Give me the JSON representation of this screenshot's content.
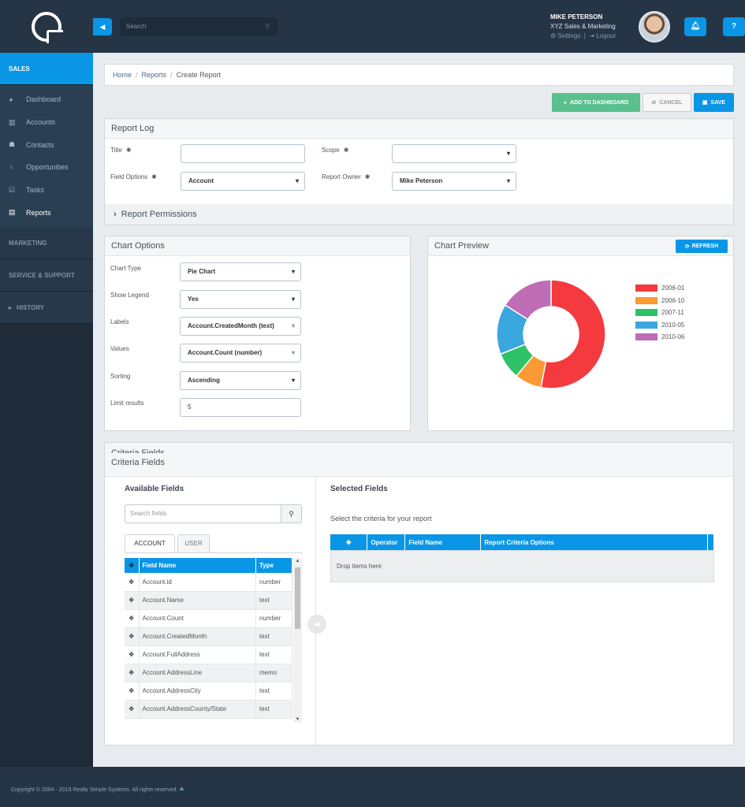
{
  "sidebar": {
    "sections": [
      {
        "label": "SALES"
      },
      {
        "label": "MARKETING"
      },
      {
        "label": "SERVICE & SUPPORT"
      },
      {
        "label": "HISTORY"
      }
    ],
    "items": [
      {
        "label": "Dashboard",
        "icon": "dashboard-icon"
      },
      {
        "label": "Accounts",
        "icon": "accounts-icon"
      },
      {
        "label": "Contacts",
        "icon": "contacts-icon"
      },
      {
        "label": "Opportunities",
        "icon": "opportunities-icon"
      },
      {
        "label": "Tasks",
        "icon": "tasks-icon"
      },
      {
        "label": "Reports",
        "icon": "reports-icon"
      }
    ]
  },
  "topbar": {
    "search_placeholder": "Search",
    "user_name": "MIKE PETERSON",
    "company": "XYZ Sales & Marketing",
    "settings_label": "Settings",
    "logout_label": "Logout",
    "help_label": "?"
  },
  "breadcrumb": [
    "Home",
    "Reports",
    "Create Report"
  ],
  "actions": {
    "add_to_dashboard": "ADD TO DASHBOARD",
    "cancel": "CANCEL",
    "save": "SAVE"
  },
  "report_log": {
    "title": "Report Log",
    "title_label": "Title",
    "title_value": "",
    "scope_label": "Scope",
    "scope_value": "",
    "field_options_label": "Field Options",
    "field_options_value": "Account",
    "report_owner_label": "Report Owner",
    "report_owner_value": "Mike Peterson",
    "permissions_label": "Report Permissions"
  },
  "chart_options": {
    "title": "Chart Options",
    "chart_type_label": "Chart Type",
    "chart_type_value": "Pie Chart",
    "show_legend_label": "Show Legend",
    "show_legend_value": "Yes",
    "labels_label": "Labels",
    "labels_value": "Account.CreatedMonth (text)",
    "values_label": "Values",
    "values_value": "Account.Count (number)",
    "sorting_label": "Sorting",
    "sorting_value": "Ascending",
    "limit_label": "Limit results",
    "limit_value": "5"
  },
  "chart_preview": {
    "title": "Chart Preview",
    "refresh_label": "REFRESH"
  },
  "chart_data": {
    "type": "pie",
    "donut": true,
    "legend_position": "right",
    "categories": [
      "2006-01",
      "2006-10",
      "2007-11",
      "2010-05",
      "2010-06"
    ],
    "values": [
      53,
      8,
      8,
      15,
      16
    ],
    "colors": [
      "#f53a3f",
      "#fb9a35",
      "#2ec266",
      "#3aa7df",
      "#bf6db5"
    ]
  },
  "criteria": {
    "ghost_title": "Criteria Fields",
    "title": "Criteria Fields",
    "available_title": "Available Fields",
    "search_placeholder": "Search fields",
    "tabs": [
      "ACCOUNT",
      "USER"
    ],
    "field_headers": [
      "Field Name",
      "Type"
    ],
    "fields": [
      {
        "name": "Account.id",
        "type": "number"
      },
      {
        "name": "Account.Name",
        "type": "text"
      },
      {
        "name": "Account.Count",
        "type": "number"
      },
      {
        "name": "Account.CreatedMonth",
        "type": "text"
      },
      {
        "name": "Account.FullAddress",
        "type": "text"
      },
      {
        "name": "Account.AddressLine",
        "type": "memo"
      },
      {
        "name": "Account.AddressCity",
        "type": "text"
      },
      {
        "name": "Account.AddressCounty/State",
        "type": "text"
      }
    ],
    "selected_title": "Selected Fields",
    "selected_intro": "Select the criteria for your report",
    "selected_headers": [
      "Operator",
      "Field Name",
      "Report Criteria Options"
    ],
    "drop_text": "Drop items here"
  },
  "footer": {
    "copyright": "Copyright © 2004 - 2019 Really Simple Systems. All rights reserved."
  }
}
